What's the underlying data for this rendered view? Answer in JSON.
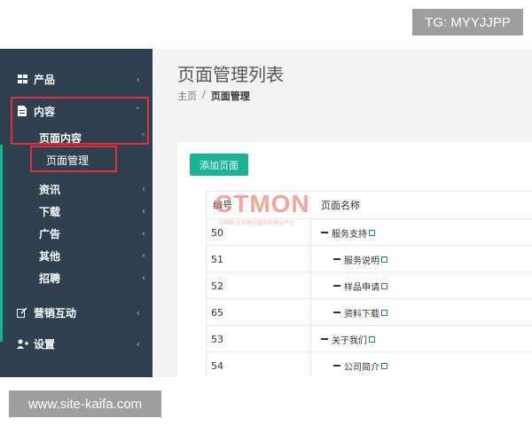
{
  "watermark_top": "TG: MYYJJPP",
  "watermark_bottom": "www.site-kaifa.com",
  "sidebar": {
    "items": [
      {
        "label": "产品",
        "icon": "grid-icon"
      },
      {
        "label": "内容",
        "icon": "document-icon"
      },
      {
        "label": "营销互动",
        "icon": "edit-icon"
      },
      {
        "label": "设置",
        "icon": "users-icon"
      }
    ],
    "content_sub": {
      "group_label": "页面内容",
      "active_leaf": "页面管理",
      "others": [
        "资讯",
        "下载",
        "广告",
        "其他",
        "招聘"
      ]
    },
    "chevron_left": "‹",
    "chevron_down": "˅",
    "accent_color": "#1ab394",
    "bg_color": "#2f4050"
  },
  "main": {
    "title": "页面管理列表",
    "breadcrumb": {
      "home": "主页",
      "sep": "/",
      "current": "页面管理"
    },
    "add_button": "添加页面",
    "table": {
      "headers": [
        "编号",
        "页面名称"
      ],
      "rows": [
        {
          "id": "50",
          "name": "服务支持",
          "level": 1
        },
        {
          "id": "51",
          "name": "服务说明",
          "level": 2
        },
        {
          "id": "52",
          "name": "样品申请",
          "level": 2
        },
        {
          "id": "65",
          "name": "资料下载",
          "level": 2
        },
        {
          "id": "53",
          "name": "关于我们",
          "level": 1
        },
        {
          "id": "54",
          "name": "公司简介",
          "level": 2
        }
      ]
    },
    "logo_text": "CTMON",
    "logo_subtext": "中国网·企业建站服务商建站平台"
  }
}
